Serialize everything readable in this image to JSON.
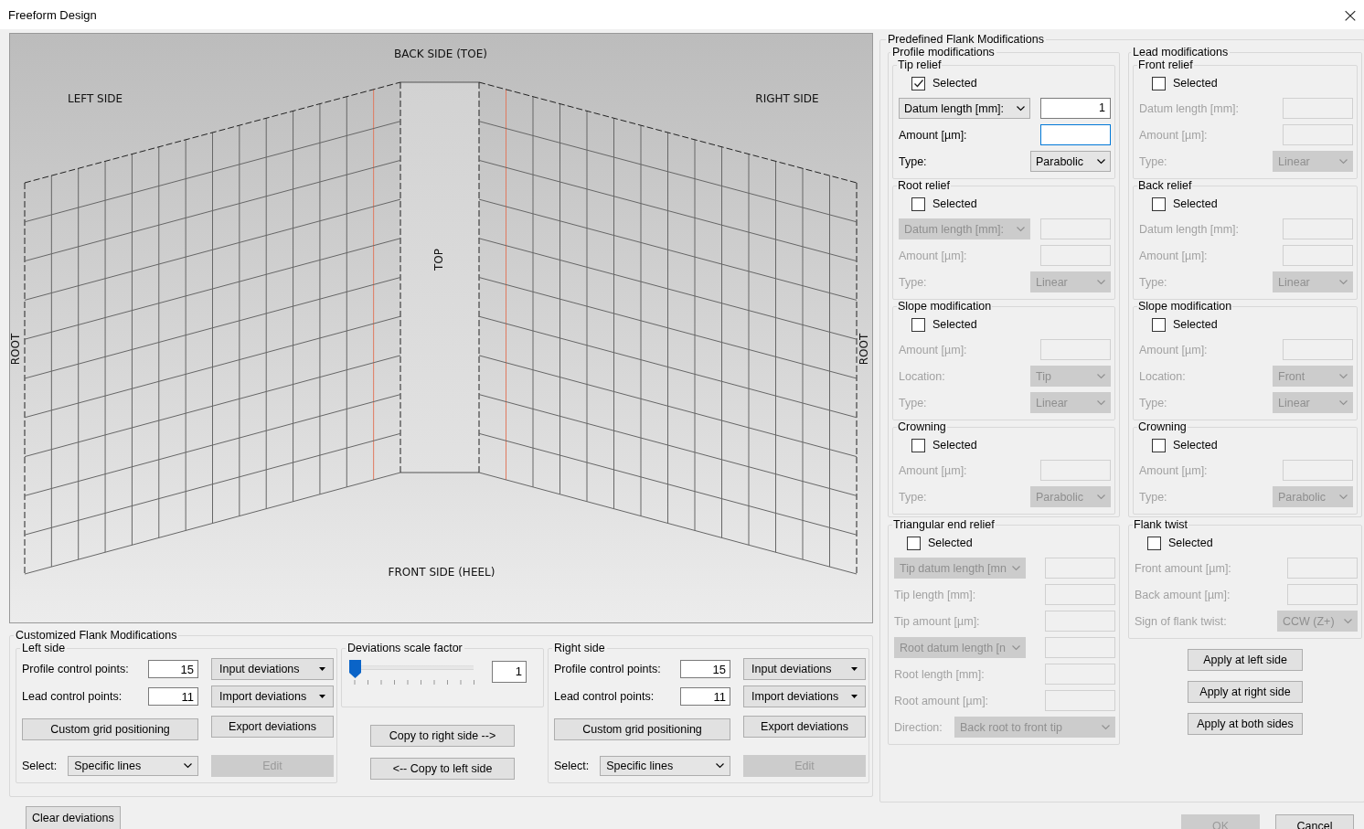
{
  "window": {
    "title": "Freeform Design",
    "close": "×"
  },
  "canvas": {
    "labels": [
      {
        "kind": "back",
        "text": "BACK SIDE (TOE)"
      },
      {
        "kind": "left",
        "text": "LEFT SIDE"
      },
      {
        "kind": "right",
        "text": "RIGHT SIDE"
      },
      {
        "kind": "top",
        "text": "TOP"
      },
      {
        "kind": "root-left",
        "text": "ROOT"
      },
      {
        "kind": "root-right",
        "text": "ROOT"
      },
      {
        "kind": "front",
        "text": "FRONT SIDE (HEEL)"
      }
    ]
  },
  "customized": {
    "title": "Customized Flank Modifications",
    "left_side": {
      "title": "Left side",
      "profile": {
        "label": "Profile control points:",
        "value": "15"
      },
      "lead": {
        "label": "Lead control points:",
        "value": "11"
      },
      "menus": [
        "Input deviations",
        "Import deviations"
      ],
      "grid_button": "Custom grid positioning",
      "export_button": "Export deviations",
      "select": {
        "label": "Select:",
        "option": "Specific lines"
      },
      "edit": {
        "label": "Edit",
        "disabled": true
      }
    },
    "scale": {
      "title": "Deviations scale factor",
      "level": 0,
      "value": "1"
    },
    "copy_buttons": [
      "Copy to right side  -->",
      "<--  Copy to left side"
    ],
    "right_side": {
      "title": "Right side",
      "profile": {
        "label": "Profile control points:",
        "value": "15"
      },
      "lead": {
        "label": "Lead control points:",
        "value": "11"
      },
      "menus": [
        "Input deviations",
        "Import deviations"
      ],
      "grid_button": "Custom grid positioning",
      "export_button": "Export deviations",
      "select": {
        "label": "Select:",
        "option": "Specific lines"
      },
      "edit": {
        "label": "Edit",
        "disabled": true
      }
    }
  },
  "predefined": {
    "title": "Predefined Flank Modifications",
    "profile": {
      "title": "Profile modifications",
      "groups": [
        {
          "title": "Tip relief",
          "check_label": "Selected",
          "checked": true,
          "rows": [
            {
              "kind": "combo",
              "option": "Datum length [mm]:",
              "value": "1",
              "focused": false
            },
            {
              "kind": "input",
              "label": "Amount [µm]:",
              "focused": true
            },
            {
              "kind": "select",
              "label": "Type:",
              "option": "Parabolic"
            }
          ]
        },
        {
          "title": "Root relief",
          "check_label": "Selected",
          "checked": false,
          "rows": [
            {
              "kind": "combo",
              "option": "Datum length [mm]:",
              "focused": false
            },
            {
              "kind": "input",
              "label": "Amount [µm]:",
              "focused": false
            },
            {
              "kind": "select",
              "label": "Type:",
              "option": "Linear"
            }
          ]
        },
        {
          "title": "Slope modification",
          "check_label": "Selected",
          "checked": false,
          "rows": [
            {
              "kind": "input",
              "label": "Amount [µm]:",
              "focused": false
            },
            {
              "kind": "select",
              "label": "Location:",
              "option": "Tip"
            },
            {
              "kind": "select",
              "label": "Type:",
              "option": "Linear"
            }
          ]
        },
        {
          "title": "Crowning",
          "check_label": "Selected",
          "checked": false,
          "rows": [
            {
              "kind": "input",
              "label": "Amount [µm]:",
              "focused": false
            },
            {
              "kind": "select",
              "label": "Type:",
              "option": "Parabolic"
            }
          ]
        }
      ]
    },
    "lead": {
      "title": "Lead modifications",
      "groups": [
        {
          "title": "Front relief",
          "check_label": "Selected",
          "checked": false,
          "rows": [
            {
              "kind": "input",
              "label": "Datum length [mm]:",
              "focused": false
            },
            {
              "kind": "input",
              "label": "Amount [µm]:",
              "focused": false
            },
            {
              "kind": "select",
              "label": "Type:",
              "option": "Linear"
            }
          ]
        },
        {
          "title": "Back relief",
          "check_label": "Selected",
          "checked": false,
          "rows": [
            {
              "kind": "input",
              "label": "Datum length [mm]:",
              "focused": false
            },
            {
              "kind": "input",
              "label": "Amount [µm]:",
              "focused": false
            },
            {
              "kind": "select",
              "label": "Type:",
              "option": "Linear"
            }
          ]
        },
        {
          "title": "Slope modification",
          "check_label": "Selected",
          "checked": false,
          "rows": [
            {
              "kind": "input",
              "label": "Amount [µm]:",
              "focused": false
            },
            {
              "kind": "select",
              "label": "Location:",
              "option": "Front"
            },
            {
              "kind": "select",
              "label": "Type:",
              "option": "Linear"
            }
          ]
        },
        {
          "title": "Crowning",
          "check_label": "Selected",
          "checked": false,
          "rows": [
            {
              "kind": "input",
              "label": "Amount [µm]:",
              "focused": false
            },
            {
              "kind": "select",
              "label": "Type:",
              "option": "Parabolic"
            }
          ]
        }
      ]
    },
    "triangular": {
      "title": "Triangular end relief",
      "check_label": "Selected",
      "checked": false,
      "rows": [
        {
          "kind": "combo",
          "option": "Tip datum length [mn",
          "focused": false
        },
        {
          "kind": "input",
          "label": "Tip length [mm]:",
          "focused": false
        },
        {
          "kind": "input",
          "label": "Tip amount [µm]:",
          "focused": false
        },
        {
          "kind": "combo",
          "option": "Root datum length [n",
          "focused": false
        },
        {
          "kind": "input",
          "label": "Root length [mm]:",
          "focused": false
        },
        {
          "kind": "input",
          "label": "Root amount [µm]:",
          "focused": false
        },
        {
          "kind": "wide-select",
          "label": "Direction:",
          "option": "Back root to front tip"
        }
      ]
    },
    "flank_twist": {
      "title": "Flank twist",
      "check_label": "Selected",
      "checked": false,
      "rows": [
        {
          "kind": "input",
          "label": "Front amount [µm]:",
          "focused": false
        },
        {
          "kind": "input",
          "label": "Back amount [µm]:",
          "focused": false
        },
        {
          "kind": "select",
          "label": "Sign of flank twist:",
          "option": "CCW (Z+)"
        }
      ]
    },
    "apply_buttons": [
      "Apply at left side",
      "Apply at right side",
      "Apply at both sides"
    ]
  },
  "footer": {
    "clear": "Clear deviations",
    "ok": {
      "label": "OK",
      "disabled": true
    },
    "cancel": "Cancel"
  }
}
